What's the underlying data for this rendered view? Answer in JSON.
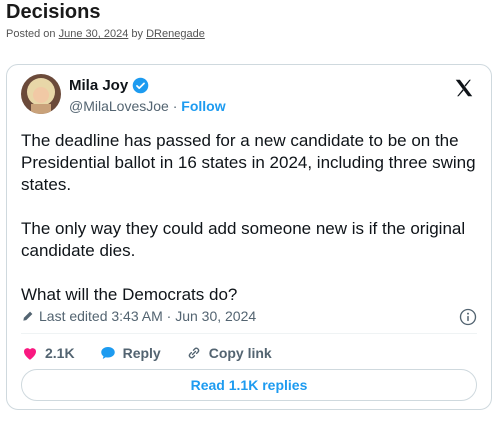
{
  "post": {
    "title": "Decisions",
    "posted_on_label": "Posted on",
    "date": "June 30, 2024",
    "by_label": "by",
    "author": "DRenegade"
  },
  "tweet": {
    "author_name": "Mila Joy",
    "handle": "@MilaLovesJoe",
    "separator": "·",
    "follow_label": "Follow",
    "text": [
      "The deadline has passed for a new candidate to be on the Presidential ballot in 16 states in 2024, including three swing states.",
      "The only way they could add someone new is if the original candidate dies.",
      "What will the Democrats do?"
    ],
    "edited_label": "Last edited 3:43 AM · Jun 30, 2024",
    "likes_count": "2.1K",
    "reply_label": "Reply",
    "copy_link_label": "Copy link",
    "read_replies_label": "Read 1.1K replies"
  },
  "colors": {
    "accent": "#1d9bf0",
    "like": "#f91880",
    "text": "#0f1419",
    "muted": "#536471"
  },
  "icons": [
    "verified-badge-icon",
    "x-logo-icon",
    "pencil-icon",
    "info-icon",
    "heart-icon",
    "reply-bubble-icon",
    "link-icon"
  ]
}
